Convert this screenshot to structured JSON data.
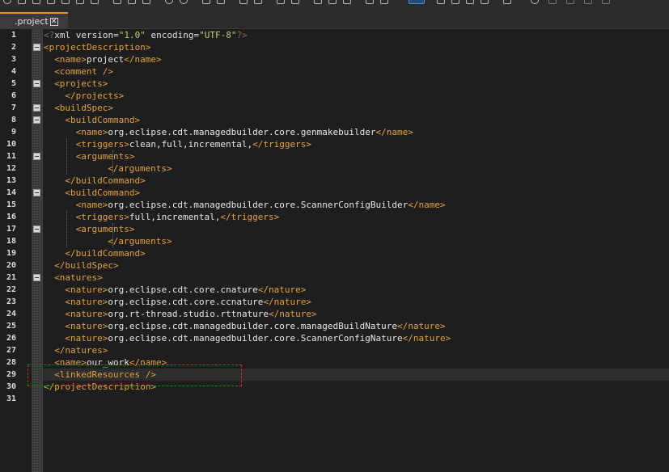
{
  "tab": {
    "label": ".project",
    "close_glyph": "✕"
  },
  "lines": [
    {
      "n": "1",
      "indent": 0,
      "tokens": [
        [
          "decl",
          "<?"
        ],
        [
          "attr",
          "xml version="
        ],
        [
          "val",
          "\"1.0\""
        ],
        [
          "attr",
          " encoding="
        ],
        [
          "val",
          "\"UTF-8\""
        ],
        [
          "decl",
          "?>"
        ]
      ]
    },
    {
      "n": "2",
      "indent": 0,
      "tokens": [
        [
          "tag",
          "<projectDescription>"
        ]
      ]
    },
    {
      "n": "3",
      "indent": 1,
      "tokens": [
        [
          "tag",
          "<name>"
        ],
        [
          "text",
          "project"
        ],
        [
          "tag",
          "</name>"
        ]
      ]
    },
    {
      "n": "4",
      "indent": 1,
      "tokens": [
        [
          "tag",
          "<comment />"
        ]
      ]
    },
    {
      "n": "5",
      "indent": 1,
      "tokens": [
        [
          "tag",
          "<projects>"
        ]
      ]
    },
    {
      "n": "6",
      "indent": 2,
      "tokens": [
        [
          "tag",
          "</projects>"
        ]
      ]
    },
    {
      "n": "7",
      "indent": 1,
      "tokens": [
        [
          "tag",
          "<buildSpec>"
        ]
      ]
    },
    {
      "n": "8",
      "indent": 2,
      "tokens": [
        [
          "tag",
          "<buildCommand>"
        ]
      ]
    },
    {
      "n": "9",
      "indent": 3,
      "tokens": [
        [
          "tag",
          "<name>"
        ],
        [
          "text",
          "org.eclipse.cdt.managedbuilder.core.genmakebuilder"
        ],
        [
          "tag",
          "</name>"
        ]
      ]
    },
    {
      "n": "10",
      "indent": 3,
      "tokens": [
        [
          "tag",
          "<triggers>"
        ],
        [
          "text",
          "clean,full,incremental,"
        ],
        [
          "tag",
          "</triggers>"
        ]
      ]
    },
    {
      "n": "11",
      "indent": 3,
      "tokens": [
        [
          "tag",
          "<arguments>"
        ]
      ]
    },
    {
      "n": "12",
      "indent": 6,
      "tokens": [
        [
          "tag",
          "</arguments>"
        ]
      ]
    },
    {
      "n": "13",
      "indent": 2,
      "tokens": [
        [
          "tag",
          "</buildCommand>"
        ]
      ]
    },
    {
      "n": "14",
      "indent": 2,
      "tokens": [
        [
          "tag",
          "<buildCommand>"
        ]
      ]
    },
    {
      "n": "15",
      "indent": 3,
      "tokens": [
        [
          "tag",
          "<name>"
        ],
        [
          "text",
          "org.eclipse.cdt.managedbuilder.core.ScannerConfigBuilder"
        ],
        [
          "tag",
          "</name>"
        ]
      ]
    },
    {
      "n": "16",
      "indent": 3,
      "tokens": [
        [
          "tag",
          "<triggers>"
        ],
        [
          "text",
          "full,incremental,"
        ],
        [
          "tag",
          "</triggers>"
        ]
      ]
    },
    {
      "n": "17",
      "indent": 3,
      "tokens": [
        [
          "tag",
          "<arguments>"
        ]
      ]
    },
    {
      "n": "18",
      "indent": 6,
      "tokens": [
        [
          "tag",
          "</arguments>"
        ]
      ]
    },
    {
      "n": "19",
      "indent": 2,
      "tokens": [
        [
          "tag",
          "</buildCommand>"
        ]
      ]
    },
    {
      "n": "20",
      "indent": 1,
      "tokens": [
        [
          "tag",
          "</buildSpec>"
        ]
      ]
    },
    {
      "n": "21",
      "indent": 1,
      "tokens": [
        [
          "tag",
          "<natures>"
        ]
      ]
    },
    {
      "n": "22",
      "indent": 2,
      "tokens": [
        [
          "tag",
          "<nature>"
        ],
        [
          "text",
          "org.eclipse.cdt.core.cnature"
        ],
        [
          "tag",
          "</nature>"
        ]
      ]
    },
    {
      "n": "23",
      "indent": 2,
      "tokens": [
        [
          "tag",
          "<nature>"
        ],
        [
          "text",
          "org.eclipse.cdt.core.ccnature"
        ],
        [
          "tag",
          "</nature>"
        ]
      ]
    },
    {
      "n": "24",
      "indent": 2,
      "tokens": [
        [
          "tag",
          "<nature>"
        ],
        [
          "text",
          "org.rt-thread.studio.rttnature"
        ],
        [
          "tag",
          "</nature>"
        ]
      ]
    },
    {
      "n": "25",
      "indent": 2,
      "tokens": [
        [
          "tag",
          "<nature>"
        ],
        [
          "text",
          "org.eclipse.cdt.managedbuilder.core.managedBuildNature"
        ],
        [
          "tag",
          "</nature>"
        ]
      ]
    },
    {
      "n": "26",
      "indent": 2,
      "tokens": [
        [
          "tag",
          "<nature>"
        ],
        [
          "text",
          "org.eclipse.cdt.managedbuilder.core.ScannerConfigNature"
        ],
        [
          "tag",
          "</nature>"
        ]
      ]
    },
    {
      "n": "27",
      "indent": 1,
      "tokens": [
        [
          "tag",
          "</natures>"
        ]
      ]
    },
    {
      "n": "28",
      "indent": 1,
      "tokens": [
        [
          "tag",
          "<name>"
        ],
        [
          "text",
          "our_work"
        ],
        [
          "tag",
          "</name>"
        ]
      ]
    },
    {
      "n": "29",
      "indent": 1,
      "tokens": [
        [
          "tag",
          "<linkedResources />"
        ]
      ]
    },
    {
      "n": "30",
      "indent": 0,
      "tokens": [
        [
          "tag",
          "</projectDescription>"
        ]
      ]
    },
    {
      "n": "31",
      "indent": 0,
      "tokens": []
    }
  ],
  "fold_lines": [
    "2",
    "5",
    "7",
    "8",
    "11",
    "14",
    "17",
    "21"
  ],
  "highlighted_line": "29",
  "annotation": {
    "style": "dashed-red-box",
    "color": "#e02020"
  },
  "colors": {
    "tag": "#e3a13c",
    "text": "#e6e6e6",
    "value": "#b5d26a",
    "tab_accent": "#e8912d",
    "background": "#1e1e1e"
  }
}
